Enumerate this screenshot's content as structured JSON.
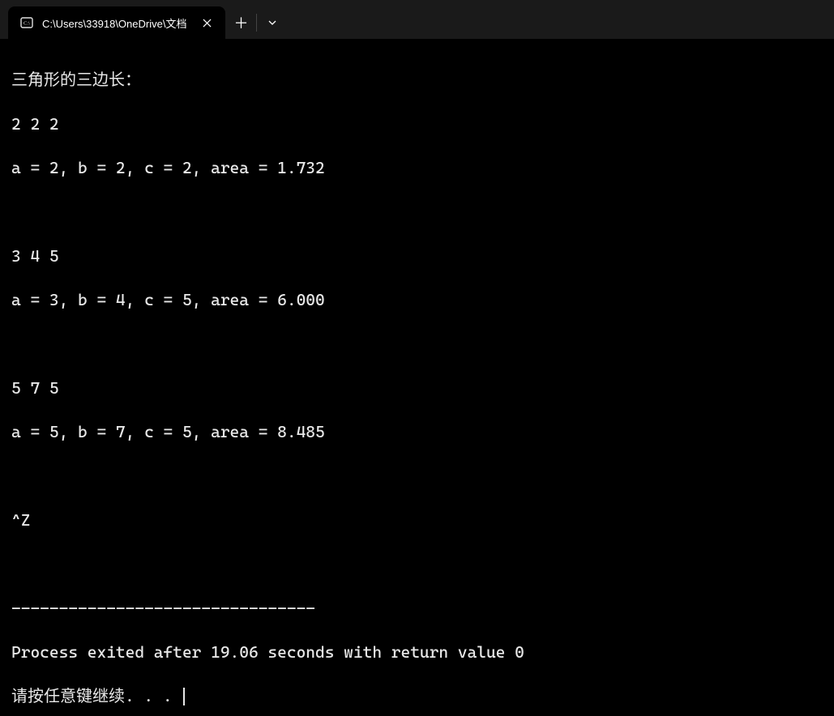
{
  "tab": {
    "title": "C:\\Users\\33918\\OneDrive\\文档"
  },
  "output": {
    "prompt": "三角形的三边长：",
    "runs": [
      {
        "input": "2 2 2",
        "result": "a = 2, b = 2, c = 2, area = 1.732"
      },
      {
        "input": "3 4 5",
        "result": "a = 3, b = 4, c = 5, area = 6.000"
      },
      {
        "input": "5 7 5",
        "result": "a = 5, b = 7, c = 5, area = 8.485"
      }
    ],
    "eof": "^Z",
    "separator": "--------------------------------",
    "exit_message": "Process exited after 19.06 seconds with return value 0",
    "press_key": "请按任意键继续. . . "
  }
}
